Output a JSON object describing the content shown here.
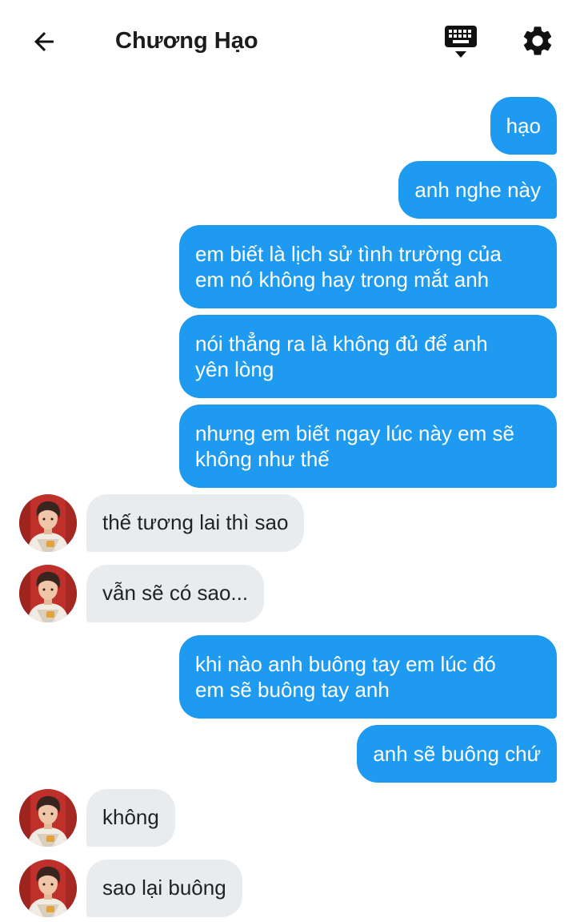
{
  "header": {
    "back_icon": "arrow-left-icon",
    "title": "Chương Hạo",
    "keyboard_icon": "keyboard-icon",
    "settings_icon": "gear-icon"
  },
  "colors": {
    "outgoing_bubble": "#1e9bf0",
    "incoming_bubble": "#e9ecef",
    "avatar_background": "#c0302a"
  },
  "messages": [
    {
      "sender": "me",
      "text": "hạo"
    },
    {
      "sender": "me",
      "text": "anh nghe này"
    },
    {
      "sender": "me",
      "lines": [
        "em biết là lịch sử tình trường của",
        "em nó không hay trong mắt anh"
      ]
    },
    {
      "sender": "me",
      "lines": [
        "nói thẳng ra là không đủ để anh",
        "yên lòng"
      ]
    },
    {
      "sender": "me",
      "lines": [
        "nhưng em biết ngay lúc này em sẽ",
        "không như thế"
      ]
    },
    {
      "sender": "them",
      "text": "thế tương lai thì sao"
    },
    {
      "sender": "them",
      "text": "vẫn sẽ có sao..."
    },
    {
      "sender": "me",
      "lines": [
        "khi nào anh buông tay em lúc đó",
        "em sẽ buông tay anh"
      ]
    },
    {
      "sender": "me",
      "text": "anh sẽ buông chứ"
    },
    {
      "sender": "them",
      "text": "không"
    },
    {
      "sender": "them",
      "text": "sao lại buông"
    }
  ]
}
